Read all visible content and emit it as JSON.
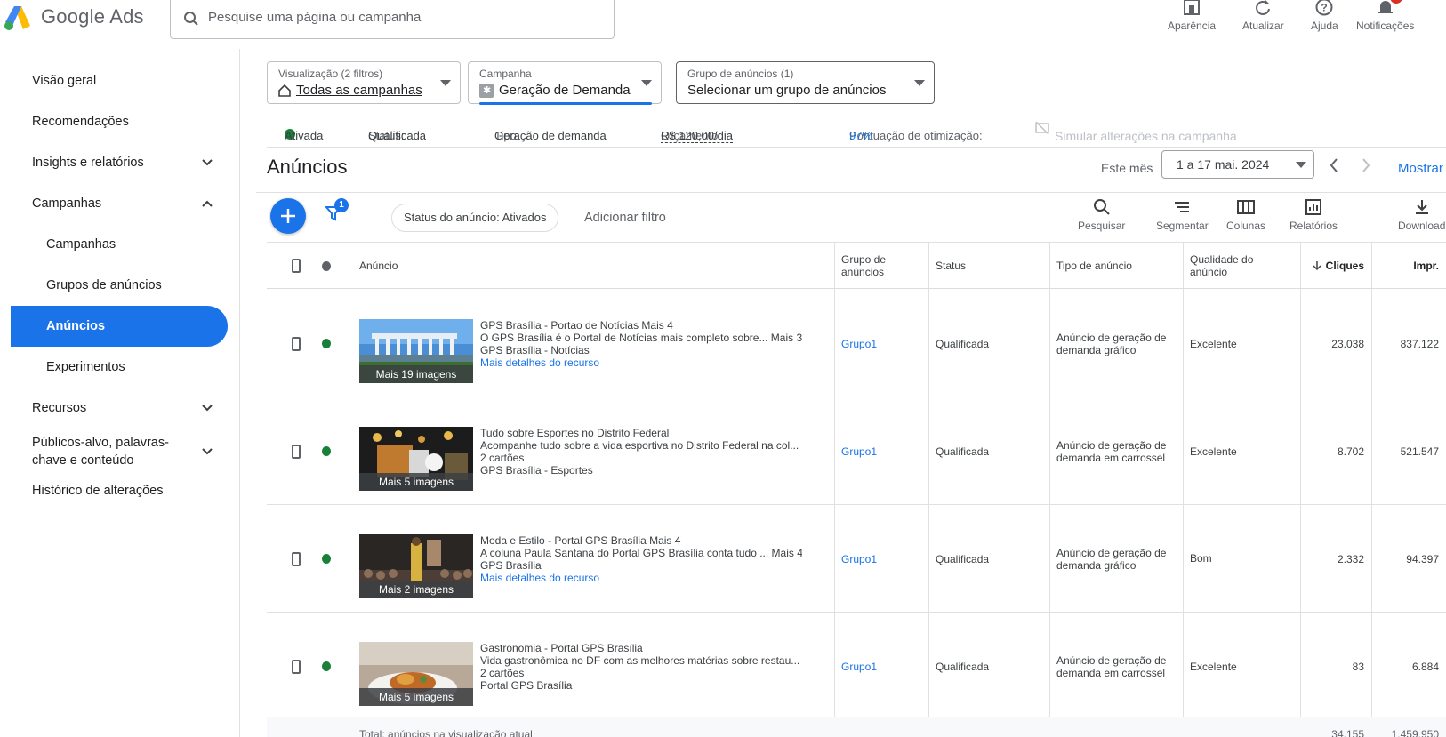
{
  "app": {
    "logo_text": "Google Ads",
    "search_placeholder": "Pesquise uma página ou campanha",
    "tools": [
      {
        "label": "Aparência",
        "icon": "appearance-icon"
      },
      {
        "label": "Atualizar",
        "icon": "refresh-icon"
      },
      {
        "label": "Ajuda",
        "icon": "help-icon"
      },
      {
        "label": "Notificações",
        "icon": "bell-icon"
      }
    ]
  },
  "sidebar": {
    "items": [
      {
        "label": "Visão geral"
      },
      {
        "label": "Recomendações"
      },
      {
        "label": "Insights e relatórios"
      },
      {
        "label": "Campanhas"
      },
      {
        "label": "Campanhas"
      },
      {
        "label": "Grupos de anúncios"
      },
      {
        "label": "Anúncios"
      },
      {
        "label": "Experimentos"
      },
      {
        "label": "Recursos"
      },
      {
        "label": "Públicos-alvo, palavras-chave e conteúdo"
      },
      {
        "label": "Histórico de alterações"
      }
    ]
  },
  "selectors": {
    "view": {
      "label": "Visualização (2 filtros)",
      "value": "Todas as campanhas"
    },
    "campaign": {
      "label": "Campanha",
      "value": "Geração de Demanda"
    },
    "adgroup": {
      "label": "Grupo de anúncios (1)",
      "value": "Selecionar um grupo de anúncios"
    }
  },
  "status_bar": {
    "state": "Ativada",
    "status_key": "Status:",
    "status_val": "Qualificada",
    "type_key": "Tipo:",
    "type_val": "Geração de demanda",
    "budget_key": "Orçamento:",
    "budget_val": "R$ 120,00/dia",
    "opt_key": "Pontuação de otimização:",
    "opt_val": "97%",
    "simulate": "Simular alterações na campanha"
  },
  "header": {
    "title": "Anúncios",
    "month_label": "Este mês",
    "date_range": "1 a 17 mai. 2024",
    "show_label": "Mostrar"
  },
  "toolbar": {
    "filter_count": "1",
    "chip": "Status do anúncio: Ativados",
    "add_filter": "Adicionar filtro",
    "buttons": [
      {
        "label": "Pesquisar"
      },
      {
        "label": "Segmentar"
      },
      {
        "label": "Colunas"
      },
      {
        "label": "Relatórios"
      },
      {
        "label": "Download"
      }
    ]
  },
  "table": {
    "columns": {
      "ad": "Anúncio",
      "adgroup": "Grupo de anúncios",
      "status": "Status",
      "type": "Tipo de anúncio",
      "quality": "Qualidade do anúncio",
      "clicks": "Cliques",
      "impr": "Impr."
    },
    "rows": [
      {
        "thumb_caption": "Mais 19 imagens",
        "line1": "GPS Brasília - Portao de Notícias Mais 4",
        "line2": "O GPS Brasília é o Portal de Notícias mais completo sobre... Mais 3",
        "line3": "GPS Brasília - Notícias",
        "line4": "Mais detalhes do recurso",
        "adgroup": "Grupo1",
        "status": "Qualificada",
        "type": "Anúncio de geração de demanda gráfico",
        "quality": "Excelente",
        "clicks": "23.038",
        "impr": "837.122"
      },
      {
        "thumb_caption": "Mais 5 imagens",
        "line1": "Tudo sobre Esportes no Distrito Federal",
        "line2": "Acompanhe tudo sobre a vida esportiva no Distrito Federal na col...",
        "line3": "2 cartões",
        "line4": "GPS Brasília - Esportes",
        "adgroup": "Grupo1",
        "status": "Qualificada",
        "type": "Anúncio de geração de demanda em carrossel",
        "quality": "Excelente",
        "clicks": "8.702",
        "impr": "521.547"
      },
      {
        "thumb_caption": "Mais 2 imagens",
        "line1": "Moda e Estilo - Portal GPS Brasília Mais 4",
        "line2": "A coluna Paula Santana do Portal GPS Brasília conta tudo ... Mais 4",
        "line3": "GPS Brasília",
        "line4": "Mais detalhes do recurso",
        "adgroup": "Grupo1",
        "status": "Qualificada",
        "type": "Anúncio de geração de demanda gráfico",
        "quality": "Bom",
        "clicks": "2.332",
        "impr": "94.397"
      },
      {
        "thumb_caption": "Mais 5 imagens",
        "line1": "Gastronomia - Portal GPS Brasília",
        "line2": "Vida gastronômica no DF com as melhores matérias sobre restau...",
        "line3": "2 cartões",
        "line4": "Portal GPS Brasília",
        "adgroup": "Grupo1",
        "status": "Qualificada",
        "type": "Anúncio de geração de demanda em carrossel",
        "quality": "Excelente",
        "clicks": "83",
        "impr": "6.884"
      }
    ],
    "footer": {
      "label": "Total: anúncios na visualização atual",
      "clicks": "34.155",
      "impr": "1.459.950"
    }
  },
  "colors": {
    "accent": "#1a73e8",
    "active_green": "#188038",
    "text": "#3c4043"
  }
}
